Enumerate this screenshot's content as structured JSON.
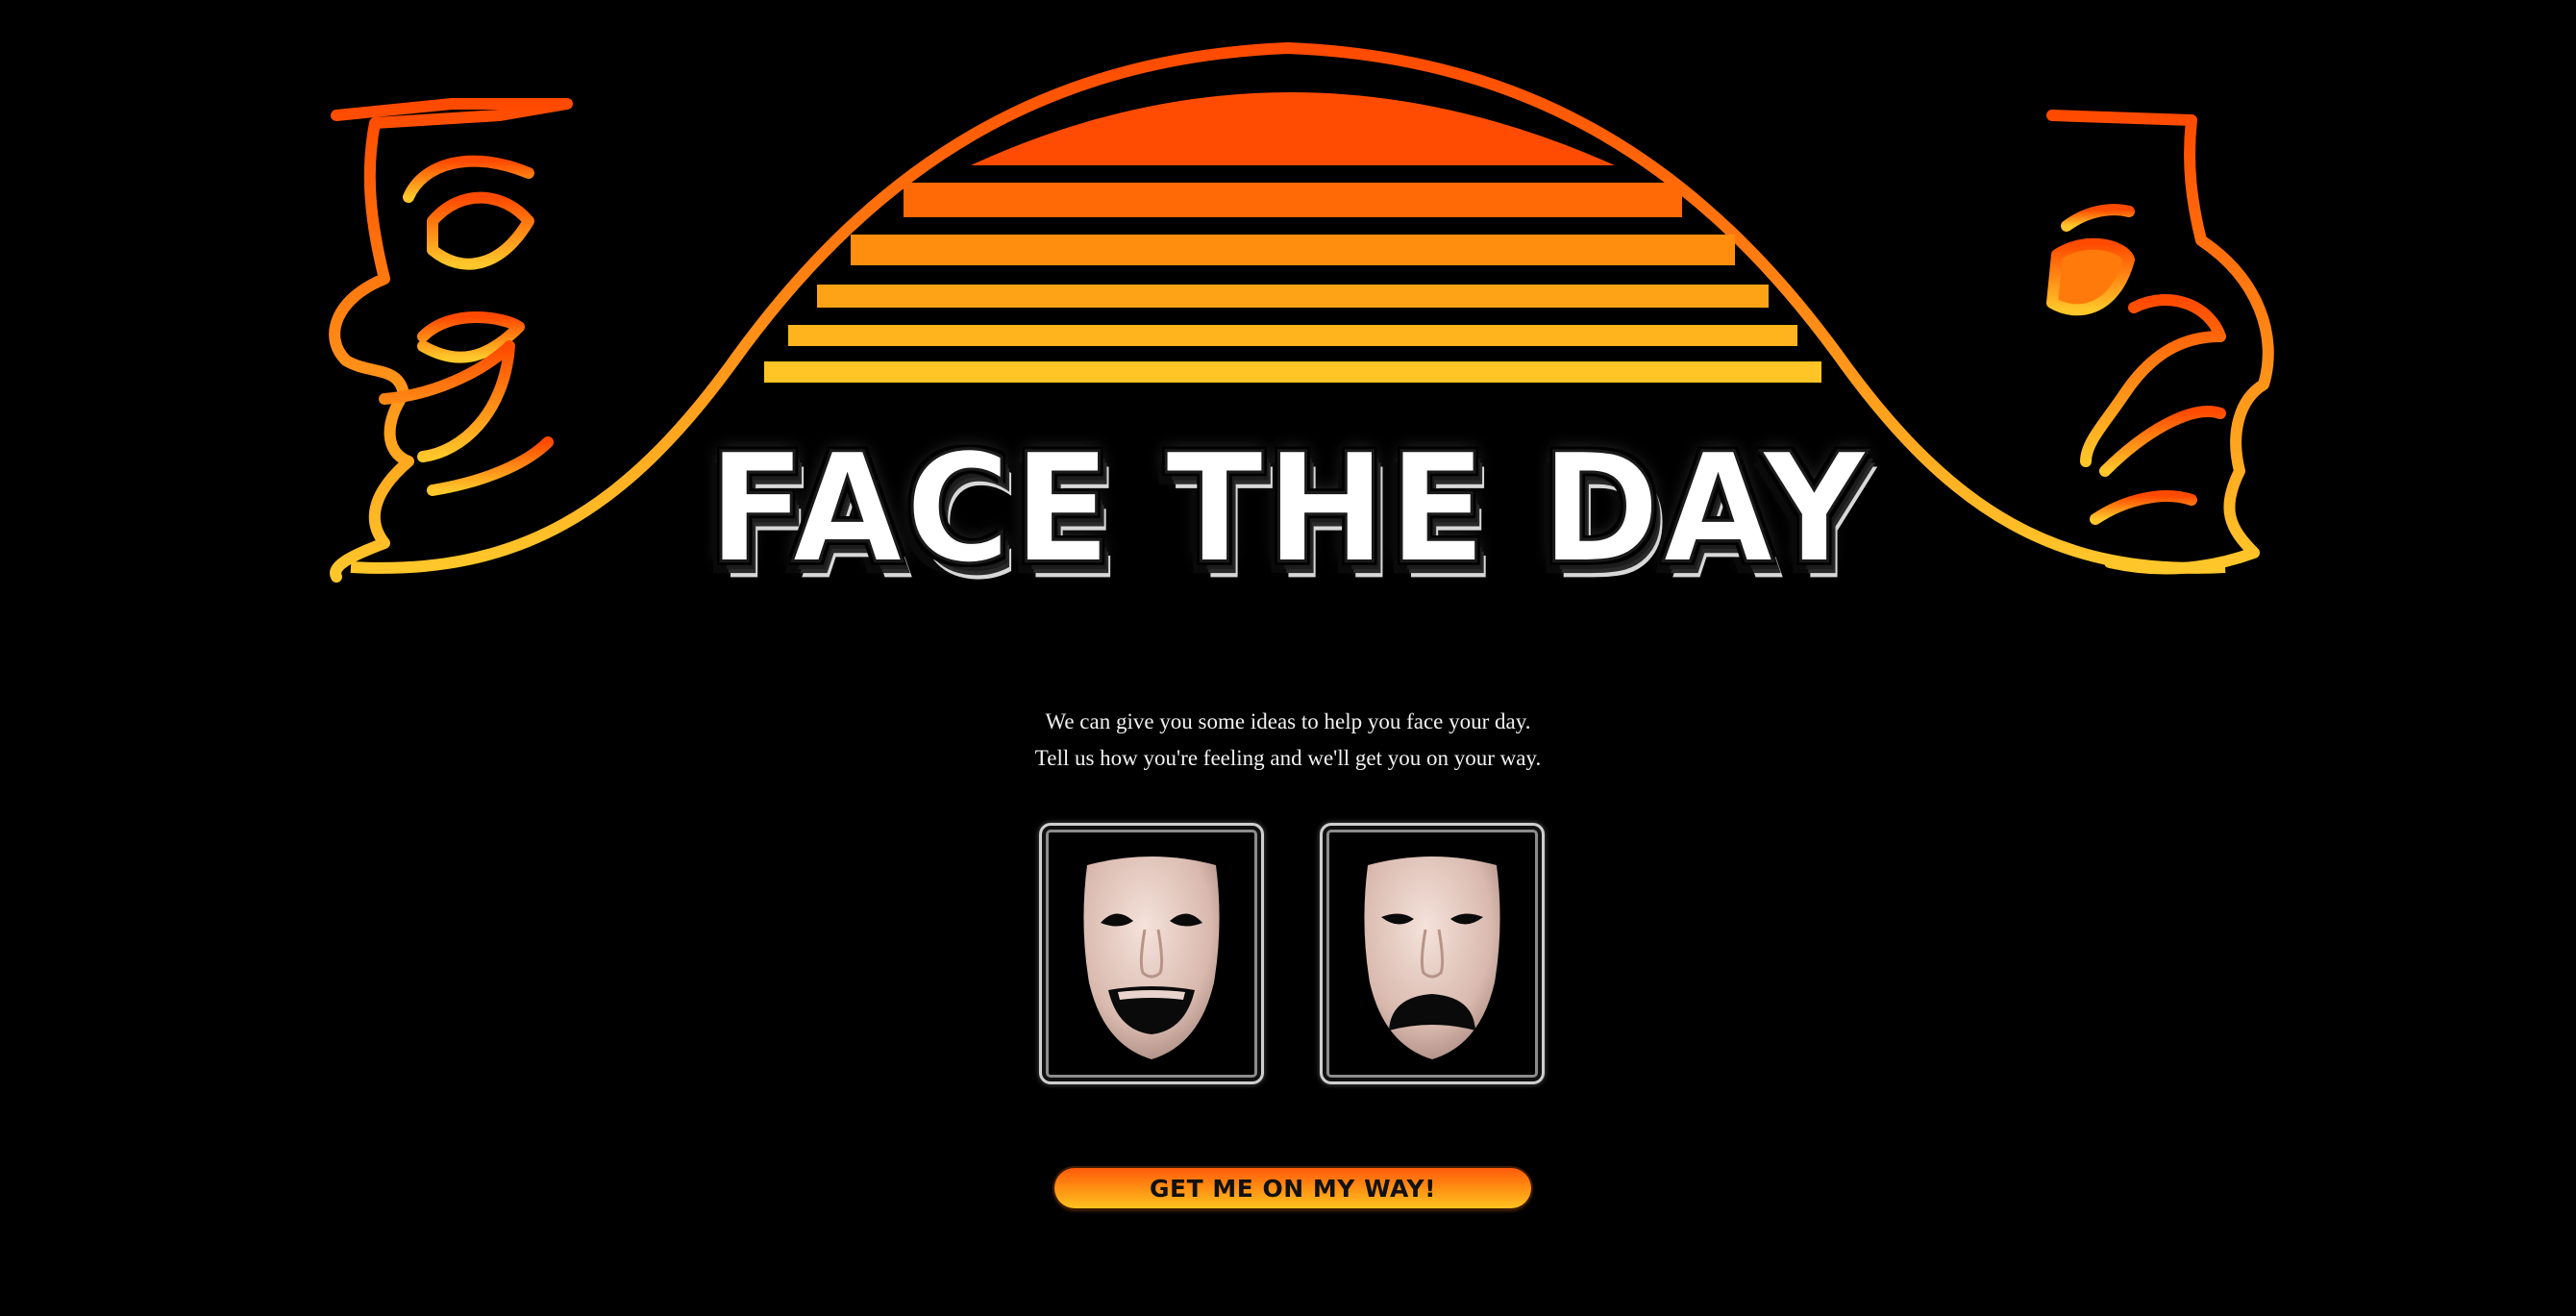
{
  "hero": {
    "title": "FACE THE DAY",
    "logo_icons": [
      "comedy-mask-outline-icon",
      "tragedy-mask-outline-icon",
      "sunset-stripes-icon"
    ]
  },
  "intro": {
    "line1": "We can give you some ideas to help you face your day.",
    "line2": "Tell us how you're feeling and we'll get you on your way."
  },
  "moods": [
    {
      "name": "happy",
      "icon": "comedy-mask-icon"
    },
    {
      "name": "sad",
      "icon": "tragedy-mask-icon"
    }
  ],
  "cta": {
    "label": "GET ME ON MY WAY!"
  },
  "colors": {
    "background": "#000000",
    "accent_top": "#ff4a00",
    "accent_bottom": "#ffc72a",
    "text": "#f2f2f2"
  }
}
